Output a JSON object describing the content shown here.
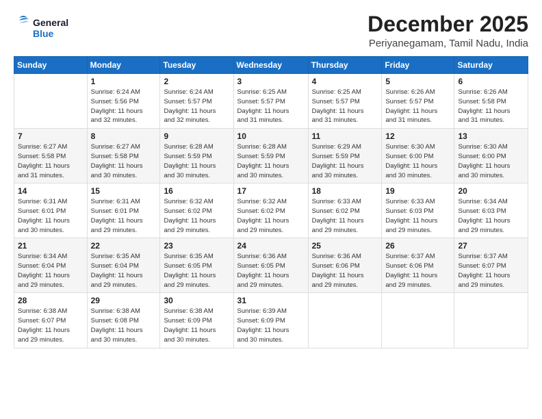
{
  "logo": {
    "line1": "General",
    "line2": "Blue"
  },
  "title": "December 2025",
  "subtitle": "Periyanegamam, Tamil Nadu, India",
  "weekdays": [
    "Sunday",
    "Monday",
    "Tuesday",
    "Wednesday",
    "Thursday",
    "Friday",
    "Saturday"
  ],
  "weeks": [
    [
      {
        "day": "",
        "info": ""
      },
      {
        "day": "1",
        "info": "Sunrise: 6:24 AM\nSunset: 5:56 PM\nDaylight: 11 hours\nand 32 minutes."
      },
      {
        "day": "2",
        "info": "Sunrise: 6:24 AM\nSunset: 5:57 PM\nDaylight: 11 hours\nand 32 minutes."
      },
      {
        "day": "3",
        "info": "Sunrise: 6:25 AM\nSunset: 5:57 PM\nDaylight: 11 hours\nand 31 minutes."
      },
      {
        "day": "4",
        "info": "Sunrise: 6:25 AM\nSunset: 5:57 PM\nDaylight: 11 hours\nand 31 minutes."
      },
      {
        "day": "5",
        "info": "Sunrise: 6:26 AM\nSunset: 5:57 PM\nDaylight: 11 hours\nand 31 minutes."
      },
      {
        "day": "6",
        "info": "Sunrise: 6:26 AM\nSunset: 5:58 PM\nDaylight: 11 hours\nand 31 minutes."
      }
    ],
    [
      {
        "day": "7",
        "info": "Sunrise: 6:27 AM\nSunset: 5:58 PM\nDaylight: 11 hours\nand 31 minutes."
      },
      {
        "day": "8",
        "info": "Sunrise: 6:27 AM\nSunset: 5:58 PM\nDaylight: 11 hours\nand 30 minutes."
      },
      {
        "day": "9",
        "info": "Sunrise: 6:28 AM\nSunset: 5:59 PM\nDaylight: 11 hours\nand 30 minutes."
      },
      {
        "day": "10",
        "info": "Sunrise: 6:28 AM\nSunset: 5:59 PM\nDaylight: 11 hours\nand 30 minutes."
      },
      {
        "day": "11",
        "info": "Sunrise: 6:29 AM\nSunset: 5:59 PM\nDaylight: 11 hours\nand 30 minutes."
      },
      {
        "day": "12",
        "info": "Sunrise: 6:30 AM\nSunset: 6:00 PM\nDaylight: 11 hours\nand 30 minutes."
      },
      {
        "day": "13",
        "info": "Sunrise: 6:30 AM\nSunset: 6:00 PM\nDaylight: 11 hours\nand 30 minutes."
      }
    ],
    [
      {
        "day": "14",
        "info": "Sunrise: 6:31 AM\nSunset: 6:01 PM\nDaylight: 11 hours\nand 30 minutes."
      },
      {
        "day": "15",
        "info": "Sunrise: 6:31 AM\nSunset: 6:01 PM\nDaylight: 11 hours\nand 29 minutes."
      },
      {
        "day": "16",
        "info": "Sunrise: 6:32 AM\nSunset: 6:02 PM\nDaylight: 11 hours\nand 29 minutes."
      },
      {
        "day": "17",
        "info": "Sunrise: 6:32 AM\nSunset: 6:02 PM\nDaylight: 11 hours\nand 29 minutes."
      },
      {
        "day": "18",
        "info": "Sunrise: 6:33 AM\nSunset: 6:02 PM\nDaylight: 11 hours\nand 29 minutes."
      },
      {
        "day": "19",
        "info": "Sunrise: 6:33 AM\nSunset: 6:03 PM\nDaylight: 11 hours\nand 29 minutes."
      },
      {
        "day": "20",
        "info": "Sunrise: 6:34 AM\nSunset: 6:03 PM\nDaylight: 11 hours\nand 29 minutes."
      }
    ],
    [
      {
        "day": "21",
        "info": "Sunrise: 6:34 AM\nSunset: 6:04 PM\nDaylight: 11 hours\nand 29 minutes."
      },
      {
        "day": "22",
        "info": "Sunrise: 6:35 AM\nSunset: 6:04 PM\nDaylight: 11 hours\nand 29 minutes."
      },
      {
        "day": "23",
        "info": "Sunrise: 6:35 AM\nSunset: 6:05 PM\nDaylight: 11 hours\nand 29 minutes."
      },
      {
        "day": "24",
        "info": "Sunrise: 6:36 AM\nSunset: 6:05 PM\nDaylight: 11 hours\nand 29 minutes."
      },
      {
        "day": "25",
        "info": "Sunrise: 6:36 AM\nSunset: 6:06 PM\nDaylight: 11 hours\nand 29 minutes."
      },
      {
        "day": "26",
        "info": "Sunrise: 6:37 AM\nSunset: 6:06 PM\nDaylight: 11 hours\nand 29 minutes."
      },
      {
        "day": "27",
        "info": "Sunrise: 6:37 AM\nSunset: 6:07 PM\nDaylight: 11 hours\nand 29 minutes."
      }
    ],
    [
      {
        "day": "28",
        "info": "Sunrise: 6:38 AM\nSunset: 6:07 PM\nDaylight: 11 hours\nand 29 minutes."
      },
      {
        "day": "29",
        "info": "Sunrise: 6:38 AM\nSunset: 6:08 PM\nDaylight: 11 hours\nand 30 minutes."
      },
      {
        "day": "30",
        "info": "Sunrise: 6:38 AM\nSunset: 6:09 PM\nDaylight: 11 hours\nand 30 minutes."
      },
      {
        "day": "31",
        "info": "Sunrise: 6:39 AM\nSunset: 6:09 PM\nDaylight: 11 hours\nand 30 minutes."
      },
      {
        "day": "",
        "info": ""
      },
      {
        "day": "",
        "info": ""
      },
      {
        "day": "",
        "info": ""
      }
    ]
  ]
}
